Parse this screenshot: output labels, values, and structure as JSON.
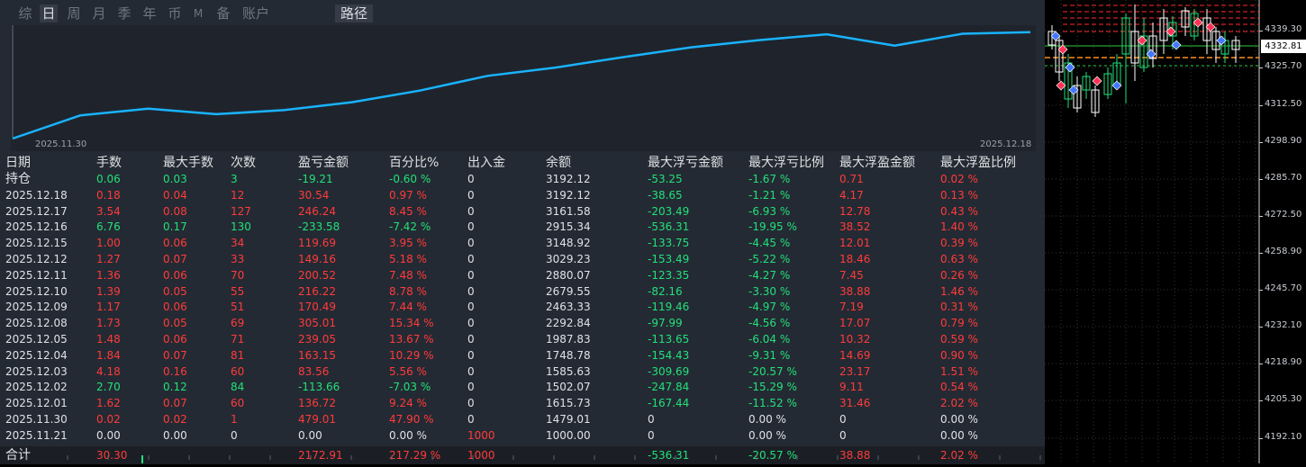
{
  "tabs": [
    {
      "label": "综",
      "active": false
    },
    {
      "label": "日",
      "active": true
    },
    {
      "label": "周",
      "active": false
    },
    {
      "label": "月",
      "active": false
    },
    {
      "label": "季",
      "active": false
    },
    {
      "label": "年",
      "active": false
    },
    {
      "label": "币",
      "active": false
    },
    {
      "label": "M",
      "active": false
    },
    {
      "label": "备",
      "active": false
    },
    {
      "label": "账户",
      "active": false
    },
    {
      "label": "路径",
      "active": true
    }
  ],
  "chart_data": {
    "type": "line",
    "x": [
      "2025.11.21",
      "2025.11.30",
      "2025.12.01",
      "2025.12.02",
      "2025.12.03",
      "2025.12.04",
      "2025.12.05",
      "2025.12.08",
      "2025.12.09",
      "2025.12.10",
      "2025.12.11",
      "2025.12.12",
      "2025.12.15",
      "2025.12.16",
      "2025.12.17",
      "2025.12.18"
    ],
    "series": [
      {
        "values": [
          1000.0,
          1479.01,
          1615.73,
          1502.07,
          1585.63,
          1748.78,
          1987.83,
          2292.84,
          2463.33,
          2679.55,
          2880.07,
          3029.23,
          3148.92,
          2915.34,
          3161.58,
          3192.12
        ]
      }
    ],
    "x_start_label": "2025.11.30",
    "x_end_label": "2025.12.18",
    "line_color": "#19b3ff"
  },
  "table": {
    "headers": [
      "日期",
      "手数",
      "最大手数",
      "次数",
      "盈亏金额",
      "百分比%",
      "出入金",
      "余额",
      "最大浮亏金额",
      "最大浮亏比例",
      "最大浮盈金额",
      "最大浮盈比例"
    ],
    "rows": [
      {
        "c": [
          "持仓",
          "0.06",
          "0.03",
          "3",
          "-19.21",
          "-0.60 %",
          "0",
          "3192.12",
          "-53.25",
          "-1.67 %",
          "0.71",
          "0.02 %"
        ],
        "k": [
          "w",
          "g",
          "g",
          "g",
          "g",
          "g",
          "w",
          "w",
          "g",
          "g",
          "r",
          "r"
        ]
      },
      {
        "c": [
          "2025.12.18",
          "0.18",
          "0.04",
          "12",
          "30.54",
          "0.97 %",
          "0",
          "3192.12",
          "-38.65",
          "-1.21 %",
          "4.17",
          "0.13 %"
        ],
        "k": [
          "w",
          "r",
          "r",
          "r",
          "r",
          "r",
          "w",
          "w",
          "g",
          "g",
          "r",
          "r"
        ]
      },
      {
        "c": [
          "2025.12.17",
          "3.54",
          "0.08",
          "127",
          "246.24",
          "8.45 %",
          "0",
          "3161.58",
          "-203.49",
          "-6.93 %",
          "12.78",
          "0.43 %"
        ],
        "k": [
          "w",
          "r",
          "r",
          "r",
          "r",
          "r",
          "w",
          "w",
          "g",
          "g",
          "r",
          "r"
        ]
      },
      {
        "c": [
          "2025.12.16",
          "6.76",
          "0.17",
          "130",
          "-233.58",
          "-7.42 %",
          "0",
          "2915.34",
          "-536.31",
          "-19.95 %",
          "38.52",
          "1.40 %"
        ],
        "k": [
          "w",
          "g",
          "g",
          "g",
          "g",
          "g",
          "w",
          "w",
          "g",
          "g",
          "r",
          "r"
        ]
      },
      {
        "c": [
          "2025.12.15",
          "1.00",
          "0.06",
          "34",
          "119.69",
          "3.95 %",
          "0",
          "3148.92",
          "-133.75",
          "-4.45 %",
          "12.01",
          "0.39 %"
        ],
        "k": [
          "w",
          "r",
          "r",
          "r",
          "r",
          "r",
          "w",
          "w",
          "g",
          "g",
          "r",
          "r"
        ]
      },
      {
        "c": [
          "2025.12.12",
          "1.27",
          "0.07",
          "33",
          "149.16",
          "5.18 %",
          "0",
          "3029.23",
          "-153.49",
          "-5.22 %",
          "18.46",
          "0.63 %"
        ],
        "k": [
          "w",
          "r",
          "r",
          "r",
          "r",
          "r",
          "w",
          "w",
          "g",
          "g",
          "r",
          "r"
        ]
      },
      {
        "c": [
          "2025.12.11",
          "1.36",
          "0.06",
          "70",
          "200.52",
          "7.48 %",
          "0",
          "2880.07",
          "-123.35",
          "-4.27 %",
          "7.45",
          "0.26 %"
        ],
        "k": [
          "w",
          "r",
          "r",
          "r",
          "r",
          "r",
          "w",
          "w",
          "g",
          "g",
          "r",
          "r"
        ]
      },
      {
        "c": [
          "2025.12.10",
          "1.39",
          "0.05",
          "55",
          "216.22",
          "8.78 %",
          "0",
          "2679.55",
          "-82.16",
          "-3.30 %",
          "38.88",
          "1.46 %"
        ],
        "k": [
          "w",
          "r",
          "r",
          "r",
          "r",
          "r",
          "w",
          "w",
          "g",
          "g",
          "r",
          "r"
        ]
      },
      {
        "c": [
          "2025.12.09",
          "1.17",
          "0.06",
          "51",
          "170.49",
          "7.44 %",
          "0",
          "2463.33",
          "-119.46",
          "-4.97 %",
          "7.19",
          "0.31 %"
        ],
        "k": [
          "w",
          "r",
          "r",
          "r",
          "r",
          "r",
          "w",
          "w",
          "g",
          "g",
          "r",
          "r"
        ]
      },
      {
        "c": [
          "2025.12.08",
          "1.73",
          "0.05",
          "69",
          "305.01",
          "15.34 %",
          "0",
          "2292.84",
          "-97.99",
          "-4.56 %",
          "17.07",
          "0.79 %"
        ],
        "k": [
          "w",
          "r",
          "r",
          "r",
          "r",
          "r",
          "w",
          "w",
          "g",
          "g",
          "r",
          "r"
        ]
      },
      {
        "c": [
          "2025.12.05",
          "1.48",
          "0.06",
          "71",
          "239.05",
          "13.67 %",
          "0",
          "1987.83",
          "-113.65",
          "-6.04 %",
          "10.32",
          "0.59 %"
        ],
        "k": [
          "w",
          "r",
          "r",
          "r",
          "r",
          "r",
          "w",
          "w",
          "g",
          "g",
          "r",
          "r"
        ]
      },
      {
        "c": [
          "2025.12.04",
          "1.84",
          "0.07",
          "81",
          "163.15",
          "10.29 %",
          "0",
          "1748.78",
          "-154.43",
          "-9.31 %",
          "14.69",
          "0.90 %"
        ],
        "k": [
          "w",
          "r",
          "r",
          "r",
          "r",
          "r",
          "w",
          "w",
          "g",
          "g",
          "r",
          "r"
        ]
      },
      {
        "c": [
          "2025.12.03",
          "4.18",
          "0.16",
          "60",
          "83.56",
          "5.56 %",
          "0",
          "1585.63",
          "-309.69",
          "-20.57 %",
          "23.17",
          "1.51 %"
        ],
        "k": [
          "w",
          "r",
          "r",
          "r",
          "r",
          "r",
          "w",
          "w",
          "g",
          "g",
          "r",
          "r"
        ]
      },
      {
        "c": [
          "2025.12.02",
          "2.70",
          "0.12",
          "84",
          "-113.66",
          "-7.03 %",
          "0",
          "1502.07",
          "-247.84",
          "-15.29 %",
          "9.11",
          "0.54 %"
        ],
        "k": [
          "w",
          "g",
          "g",
          "g",
          "g",
          "g",
          "w",
          "w",
          "g",
          "g",
          "r",
          "r"
        ]
      },
      {
        "c": [
          "2025.12.01",
          "1.62",
          "0.07",
          "60",
          "136.72",
          "9.24 %",
          "0",
          "1615.73",
          "-167.44",
          "-11.52 %",
          "31.46",
          "2.02 %"
        ],
        "k": [
          "w",
          "r",
          "r",
          "r",
          "r",
          "r",
          "w",
          "w",
          "g",
          "g",
          "r",
          "r"
        ]
      },
      {
        "c": [
          "2025.11.30",
          "0.02",
          "0.02",
          "1",
          "479.01",
          "47.90 %",
          "0",
          "1479.01",
          "0",
          "0.00 %",
          "0",
          "0.00 %"
        ],
        "k": [
          "w",
          "r",
          "r",
          "r",
          "r",
          "r",
          "w",
          "w",
          "w",
          "w",
          "w",
          "w"
        ]
      },
      {
        "c": [
          "2025.11.21",
          "0.00",
          "0.00",
          "0",
          "0.00",
          "0.00 %",
          "1000",
          "1000.00",
          "0",
          "0.00 %",
          "0",
          "0.00 %"
        ],
        "k": [
          "w",
          "w",
          "w",
          "w",
          "w",
          "w",
          "r",
          "w",
          "w",
          "w",
          "w",
          "w"
        ]
      }
    ],
    "total": {
      "c": [
        "合计",
        "30.30",
        "",
        "",
        "2172.91",
        "217.29 %",
        "1000",
        "",
        "-536.31",
        "-20.57 %",
        "38.88",
        "2.02 %"
      ],
      "k": [
        "w",
        "r",
        "w",
        "w",
        "r",
        "r",
        "r",
        "w",
        "g",
        "g",
        "r",
        "r"
      ]
    }
  },
  "colors": {
    "red": "#ff3b3b",
    "green": "#22e07a",
    "white": "#dfe3e8",
    "bg": "#242a33"
  },
  "price_axis": {
    "labels": [
      "4339.30",
      "4325.70",
      "4312.50",
      "4298.90",
      "4285.70",
      "4272.50",
      "4258.90",
      "4245.70",
      "4232.10",
      "4218.90",
      "4205.30",
      "4192.10"
    ],
    "current": "4332.81"
  }
}
